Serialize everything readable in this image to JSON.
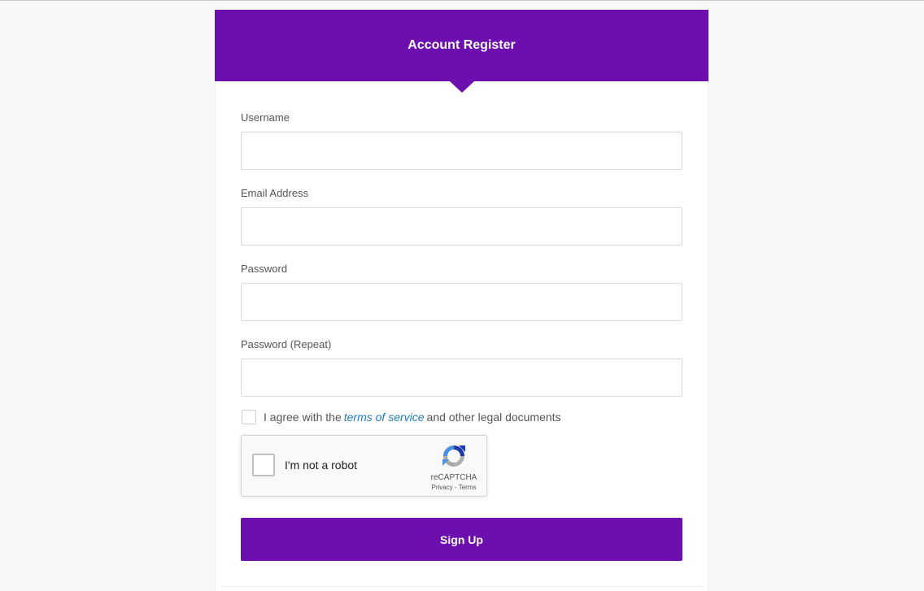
{
  "header": {
    "title": "Account Register"
  },
  "form": {
    "username": {
      "label": "Username",
      "value": "",
      "placeholder": ""
    },
    "email": {
      "label": "Email Address",
      "value": "",
      "placeholder": ""
    },
    "password": {
      "label": "Password",
      "value": "",
      "placeholder": ""
    },
    "password_repeat": {
      "label": "Password (Repeat)",
      "value": "",
      "placeholder": ""
    },
    "agree": {
      "prefix": "I agree with the",
      "link": "terms of service",
      "suffix": "and other legal documents",
      "checked": false
    },
    "recaptcha": {
      "label": "I'm not a robot",
      "brand": "reCAPTCHA",
      "links": "Privacy - Terms",
      "icon": "recaptcha-logo-icon"
    },
    "submit_label": "Sign Up"
  },
  "colors": {
    "brand": "#6c0fae",
    "link": "#1e7bb8",
    "background": "#f8f8f8"
  }
}
